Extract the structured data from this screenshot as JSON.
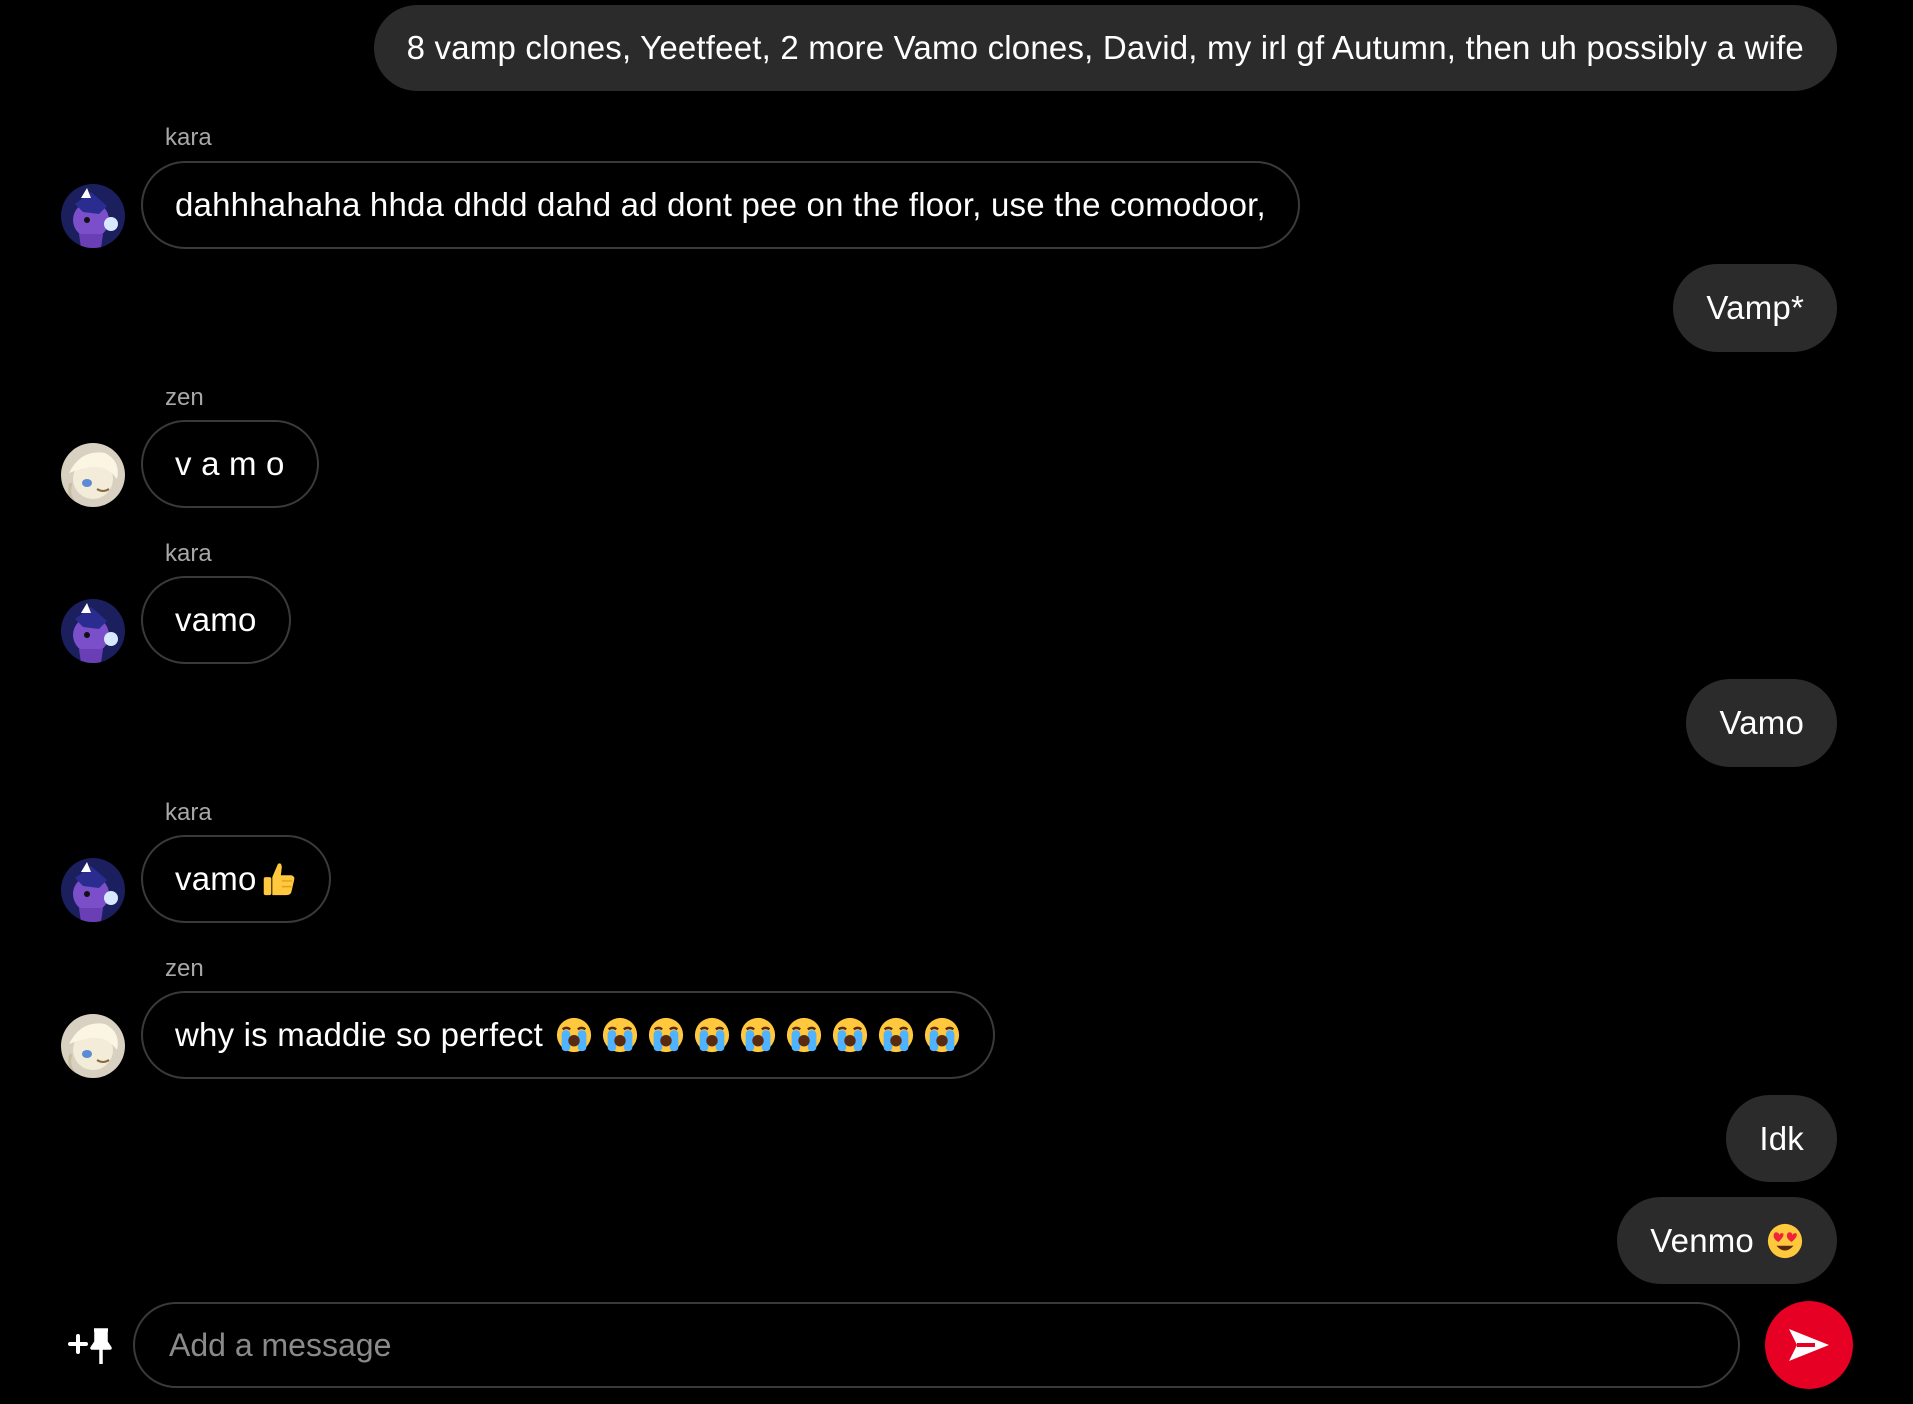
{
  "messages": [
    {
      "id": "m1",
      "direction": "outgoing",
      "text": "8 vamp clones, Yeetfeet, 2 more Vamo clones, David, my irl gf Autumn, then uh possibly a wife"
    },
    {
      "id": "m2",
      "direction": "incoming",
      "sender": "kara",
      "avatar": "kara-avatar",
      "text": "dahhhahaha hhda dhdd dahd ad dont pee on the floor, use the comodoor,"
    },
    {
      "id": "m3",
      "direction": "outgoing",
      "text": "Vamp*"
    },
    {
      "id": "m4",
      "direction": "incoming",
      "sender": "zen",
      "avatar": "zen-avatar",
      "text": "v a m o"
    },
    {
      "id": "m5",
      "direction": "incoming",
      "sender": "kara",
      "avatar": "kara-avatar",
      "text": "vamo"
    },
    {
      "id": "m6",
      "direction": "outgoing",
      "text": "Vamo"
    },
    {
      "id": "m7",
      "direction": "incoming",
      "sender": "kara",
      "avatar": "kara-avatar",
      "text": "vamo",
      "emoji": "thumbs-up-emoji"
    },
    {
      "id": "m8",
      "direction": "incoming",
      "sender": "zen",
      "avatar": "zen-avatar",
      "text": "why is maddie so perfect",
      "emoji": "loudly-crying-emoji",
      "emoji_count": 9
    },
    {
      "id": "m9",
      "direction": "outgoing",
      "text": "Idk"
    },
    {
      "id": "m10",
      "direction": "outgoing",
      "text": "Venmo",
      "emoji": "heart-eyes-emoji"
    }
  ],
  "composer": {
    "placeholder": "Add a message",
    "value": "",
    "pin_icon": "plus-pin-icon",
    "send_icon": "send-arrow-icon"
  },
  "colors": {
    "background": "#000000",
    "outgoing_bubble": "#2b2b2b",
    "incoming_border": "#3a3a3a",
    "sender_label": "#a8a8a8",
    "send_button": "#e60023"
  }
}
